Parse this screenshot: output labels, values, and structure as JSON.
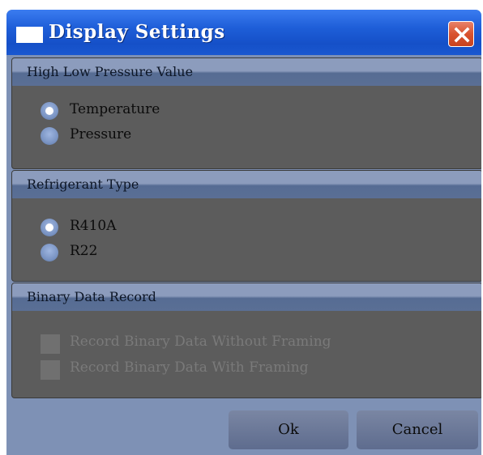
{
  "window": {
    "title": "Display Settings"
  },
  "groups": [
    {
      "title": "High Low Pressure Value",
      "options": [
        {
          "label": "Temperature",
          "checked": true
        },
        {
          "label": "Pressure",
          "checked": false
        }
      ]
    },
    {
      "title": "Refrigerant Type",
      "options": [
        {
          "label": "R410A",
          "checked": true
        },
        {
          "label": "R22",
          "checked": false
        }
      ]
    },
    {
      "title": "Binary Data Record",
      "options": [
        {
          "label": "Record Binary Data Without Framing",
          "checked": false,
          "enabled": false
        },
        {
          "label": "Record Binary Data With Framing",
          "checked": false,
          "enabled": false
        }
      ]
    }
  ],
  "buttons": {
    "ok": "Ok",
    "cancel": "Cancel"
  }
}
